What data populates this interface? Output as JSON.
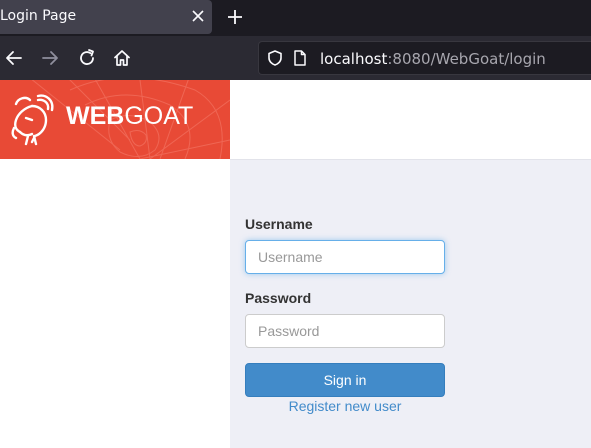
{
  "browser": {
    "tab_title": "Login Page",
    "url_host": "localhost",
    "url_rest": ":8080/WebGoat/login",
    "icons": [
      "close-icon",
      "plus-icon",
      "back-arrow-icon",
      "forward-arrow-icon",
      "reload-icon",
      "home-icon",
      "shield-icon",
      "page-icon"
    ]
  },
  "brand": {
    "bold": "WEB",
    "light": "GOAT",
    "color": "#e84a36"
  },
  "form": {
    "username_label": "Username",
    "username_placeholder": "Username",
    "password_label": "Password",
    "password_placeholder": "Password",
    "submit_label": "Sign in",
    "register_link": "Register new user"
  }
}
